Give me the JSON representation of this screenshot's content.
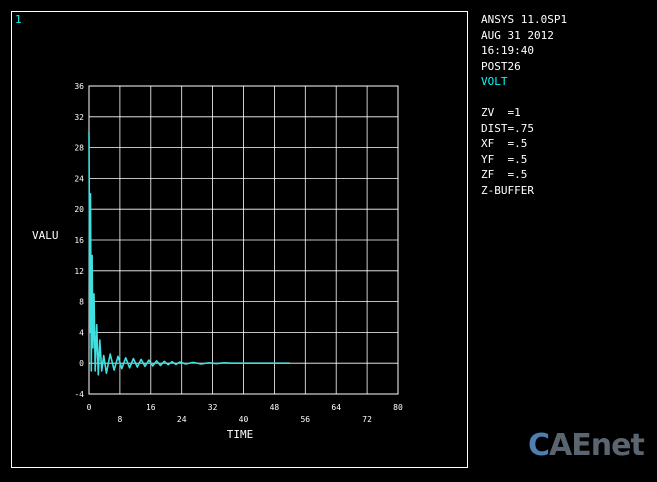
{
  "window": {
    "number": "1"
  },
  "info": {
    "product": "ANSYS 11.0SP1",
    "date": "AUG 31 2012",
    "time": "16:19:40",
    "module": "POST26",
    "variable": "VOLT",
    "zv": "ZV  =1",
    "dist": "DIST=.75",
    "xf": "XF  =.5",
    "yf": "YF  =.5",
    "zf": "ZF  =.5",
    "zbuffer": "Z-BUFFER"
  },
  "watermark": {
    "part1": "C",
    "part2": "AE",
    "part3": "net"
  },
  "colors": {
    "background": "#000000",
    "foreground": "#ffffff",
    "curve": "#40e0e0",
    "accent": "#00ffff"
  },
  "chart_data": {
    "type": "line",
    "xlabel": "TIME",
    "ylabel": "VALU",
    "xlim": [
      0,
      80
    ],
    "ylim": [
      -4,
      36
    ],
    "x_ticks": [
      "0",
      "8",
      "16",
      "24",
      "32",
      "40",
      "48",
      "56",
      "64",
      "72",
      "80"
    ],
    "y_ticks": [
      "-4",
      "0",
      "4",
      "8",
      "12",
      "16",
      "20",
      "24",
      "28",
      "32",
      "36"
    ],
    "grid": true,
    "series": [
      {
        "x": [
          0,
          0.2,
          0.4,
          0.6,
          0.8,
          1.0,
          1.3,
          1.6,
          2.0,
          2.4,
          2.8,
          3.3,
          3.8,
          4.5,
          5.5,
          6.5,
          7.5,
          8.5,
          9.5,
          10.5,
          11.5,
          12.5,
          13.5,
          14.5,
          15.5,
          16.5,
          17.5,
          18.5,
          19.5,
          20.5,
          21.5,
          22.5,
          23.5,
          25,
          27,
          29,
          31,
          33,
          35,
          37,
          40,
          44,
          48,
          52
        ],
        "y": [
          30,
          4,
          22,
          -1,
          14,
          2,
          9,
          -1,
          5,
          -1.5,
          3,
          -1,
          1,
          -1.3,
          1.2,
          -0.9,
          0.9,
          -0.7,
          0.7,
          -0.6,
          0.6,
          -0.5,
          0.5,
          -0.4,
          0.4,
          -0.35,
          0.3,
          -0.3,
          0.25,
          -0.2,
          0.2,
          -0.15,
          0.15,
          -0.1,
          0.1,
          -0.1,
          0.05,
          -0.05,
          0.05,
          0,
          0,
          0,
          0,
          0
        ]
      }
    ]
  }
}
